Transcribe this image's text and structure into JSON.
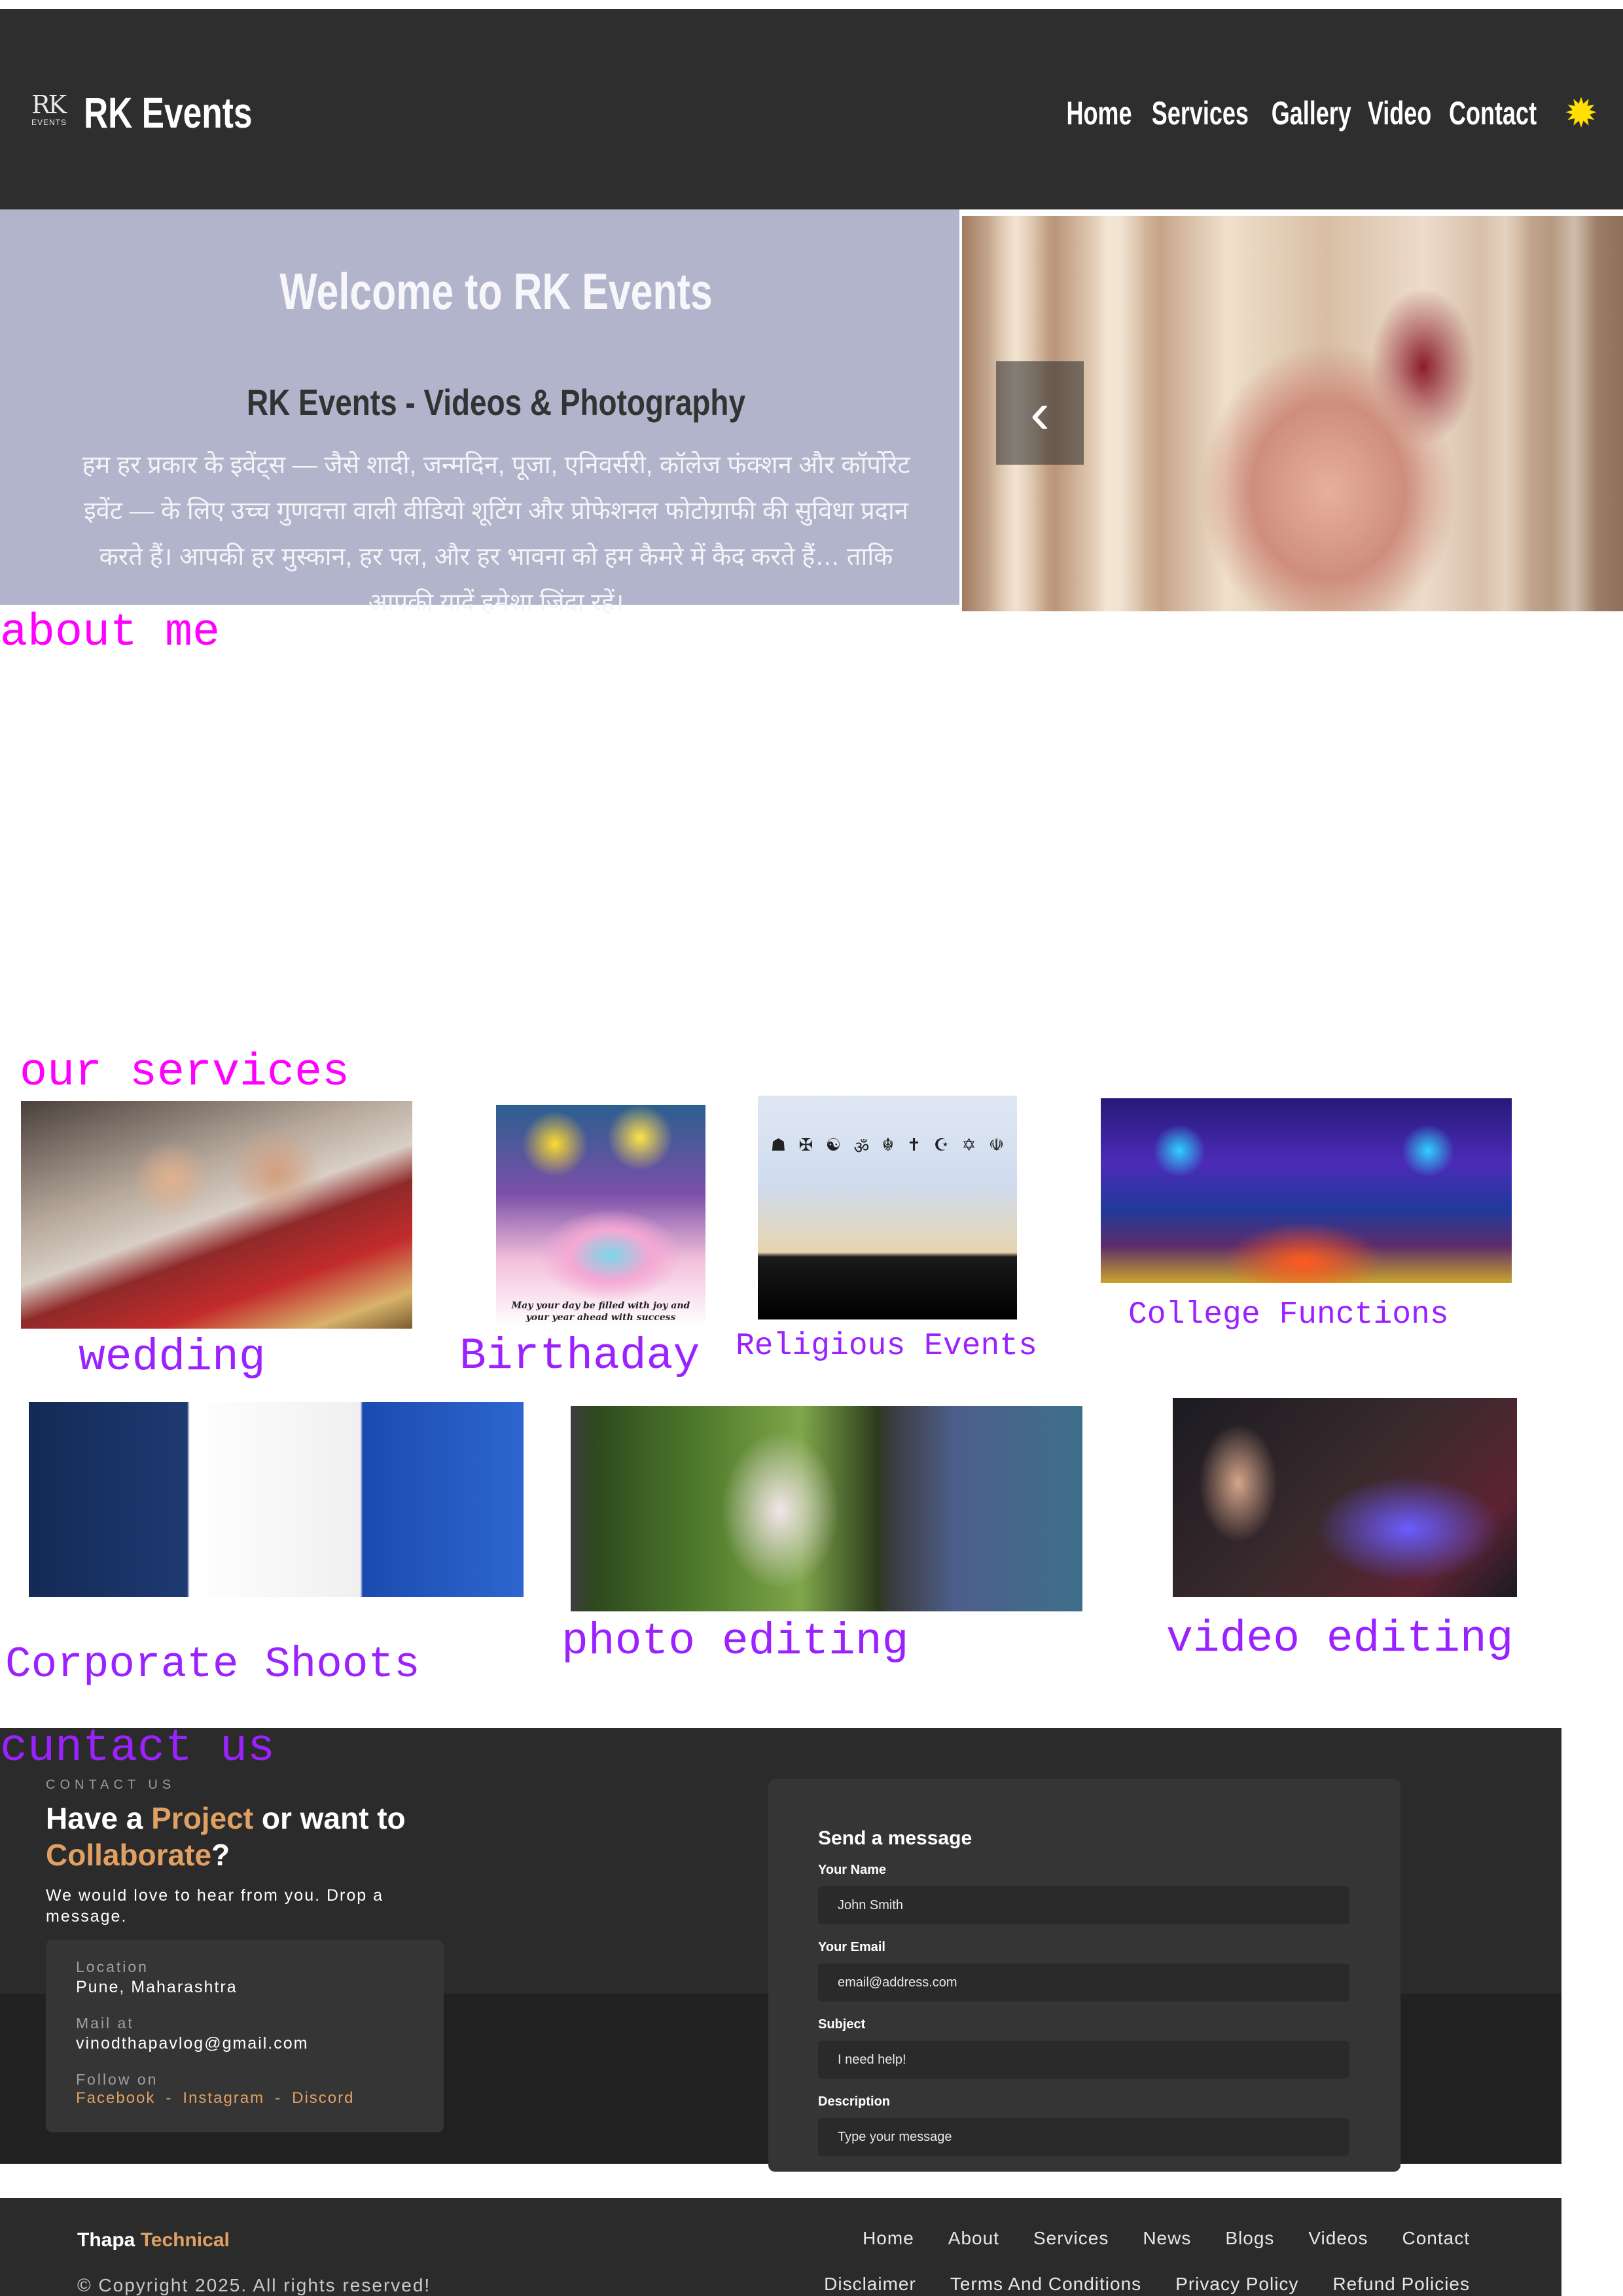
{
  "header": {
    "logo_text": "RK",
    "logo_sub": "EVENTS",
    "brand": "RK Events",
    "nav": [
      "Home",
      "Services",
      "Gallery",
      "Video",
      "Contact"
    ],
    "theme_icon": "sun-icon"
  },
  "hero": {
    "title": "Welcome to RK Events",
    "subtitle": "RK Events - Videos & Photography",
    "description": "हम हर प्रकार के इवेंट्स — जैसे शादी, जन्मदिन, पूजा, एनिवर्सरी, कॉलेज फंक्शन और कॉर्पोरेट इवेंट — के लिए उच्च गुणवत्ता वाली वीडियो शूटिंग और प्रोफेशनल फोटोग्राफी की सुविधा प्रदान करते हैं। आपकी हर मुस्कान, हर पल, और हर भावना को हम कैमरे में कैद करते हैं… ताकि आपकी यादें हमेशा जिंदा रहें।",
    "prev_icon": "chevron-left-icon"
  },
  "about": {
    "heading": "about me"
  },
  "services": {
    "heading": "our services",
    "items": [
      {
        "label": "wedding"
      },
      {
        "label": "Birthaday"
      },
      {
        "label": "Religious Events"
      },
      {
        "label": "College Functions"
      },
      {
        "label": "Corporate Shoots"
      },
      {
        "label": "photo editing"
      },
      {
        "label": "video editing"
      }
    ],
    "birthday_card_text": "May your day be filled with joy and your year ahead with success"
  },
  "contact": {
    "heading": "cuntact us",
    "eyebrow": "CONTACT US",
    "title_part1": "Have a ",
    "title_accent1": "Project",
    "title_part2": " or want to ",
    "title_accent2": "Collaborate",
    "title_part3": "?",
    "text": "We would love to hear from you. Drop a message.",
    "location_label": "Location",
    "location_value": "Pune, Maharashtra",
    "mail_label": "Mail at",
    "mail_value": "vinodthapavlog@gmail.com",
    "follow_label": "Follow on",
    "social": [
      "Facebook",
      "Instagram",
      "Discord"
    ],
    "form": {
      "title": "Send a message",
      "name_label": "Your Name",
      "name_placeholder": "John Smith",
      "email_label": "Your Email",
      "email_placeholder": "email@address.com",
      "subject_label": "Subject",
      "subject_placeholder": "I need help!",
      "description_label": "Description",
      "description_placeholder": "Type your message"
    }
  },
  "footer": {
    "brand_part1": "Thapa ",
    "brand_accent": "Technical",
    "nav": [
      "Home",
      "About",
      "Services",
      "News",
      "Blogs",
      "Videos",
      "Contact"
    ],
    "copyright": "© Copyright 2025. All rights reserved!",
    "legal": [
      "Disclaimer",
      "Terms And Conditions",
      "Privacy Policy",
      "Refund Policies"
    ]
  },
  "colors": {
    "header_bg": "#2e2e2e",
    "hero_panel": "#b2b4cb",
    "heading_pink": "#ff00ff",
    "heading_purple": "#9b22ff",
    "accent_orange": "#e0a063",
    "theme_icon": "#ffe000"
  }
}
